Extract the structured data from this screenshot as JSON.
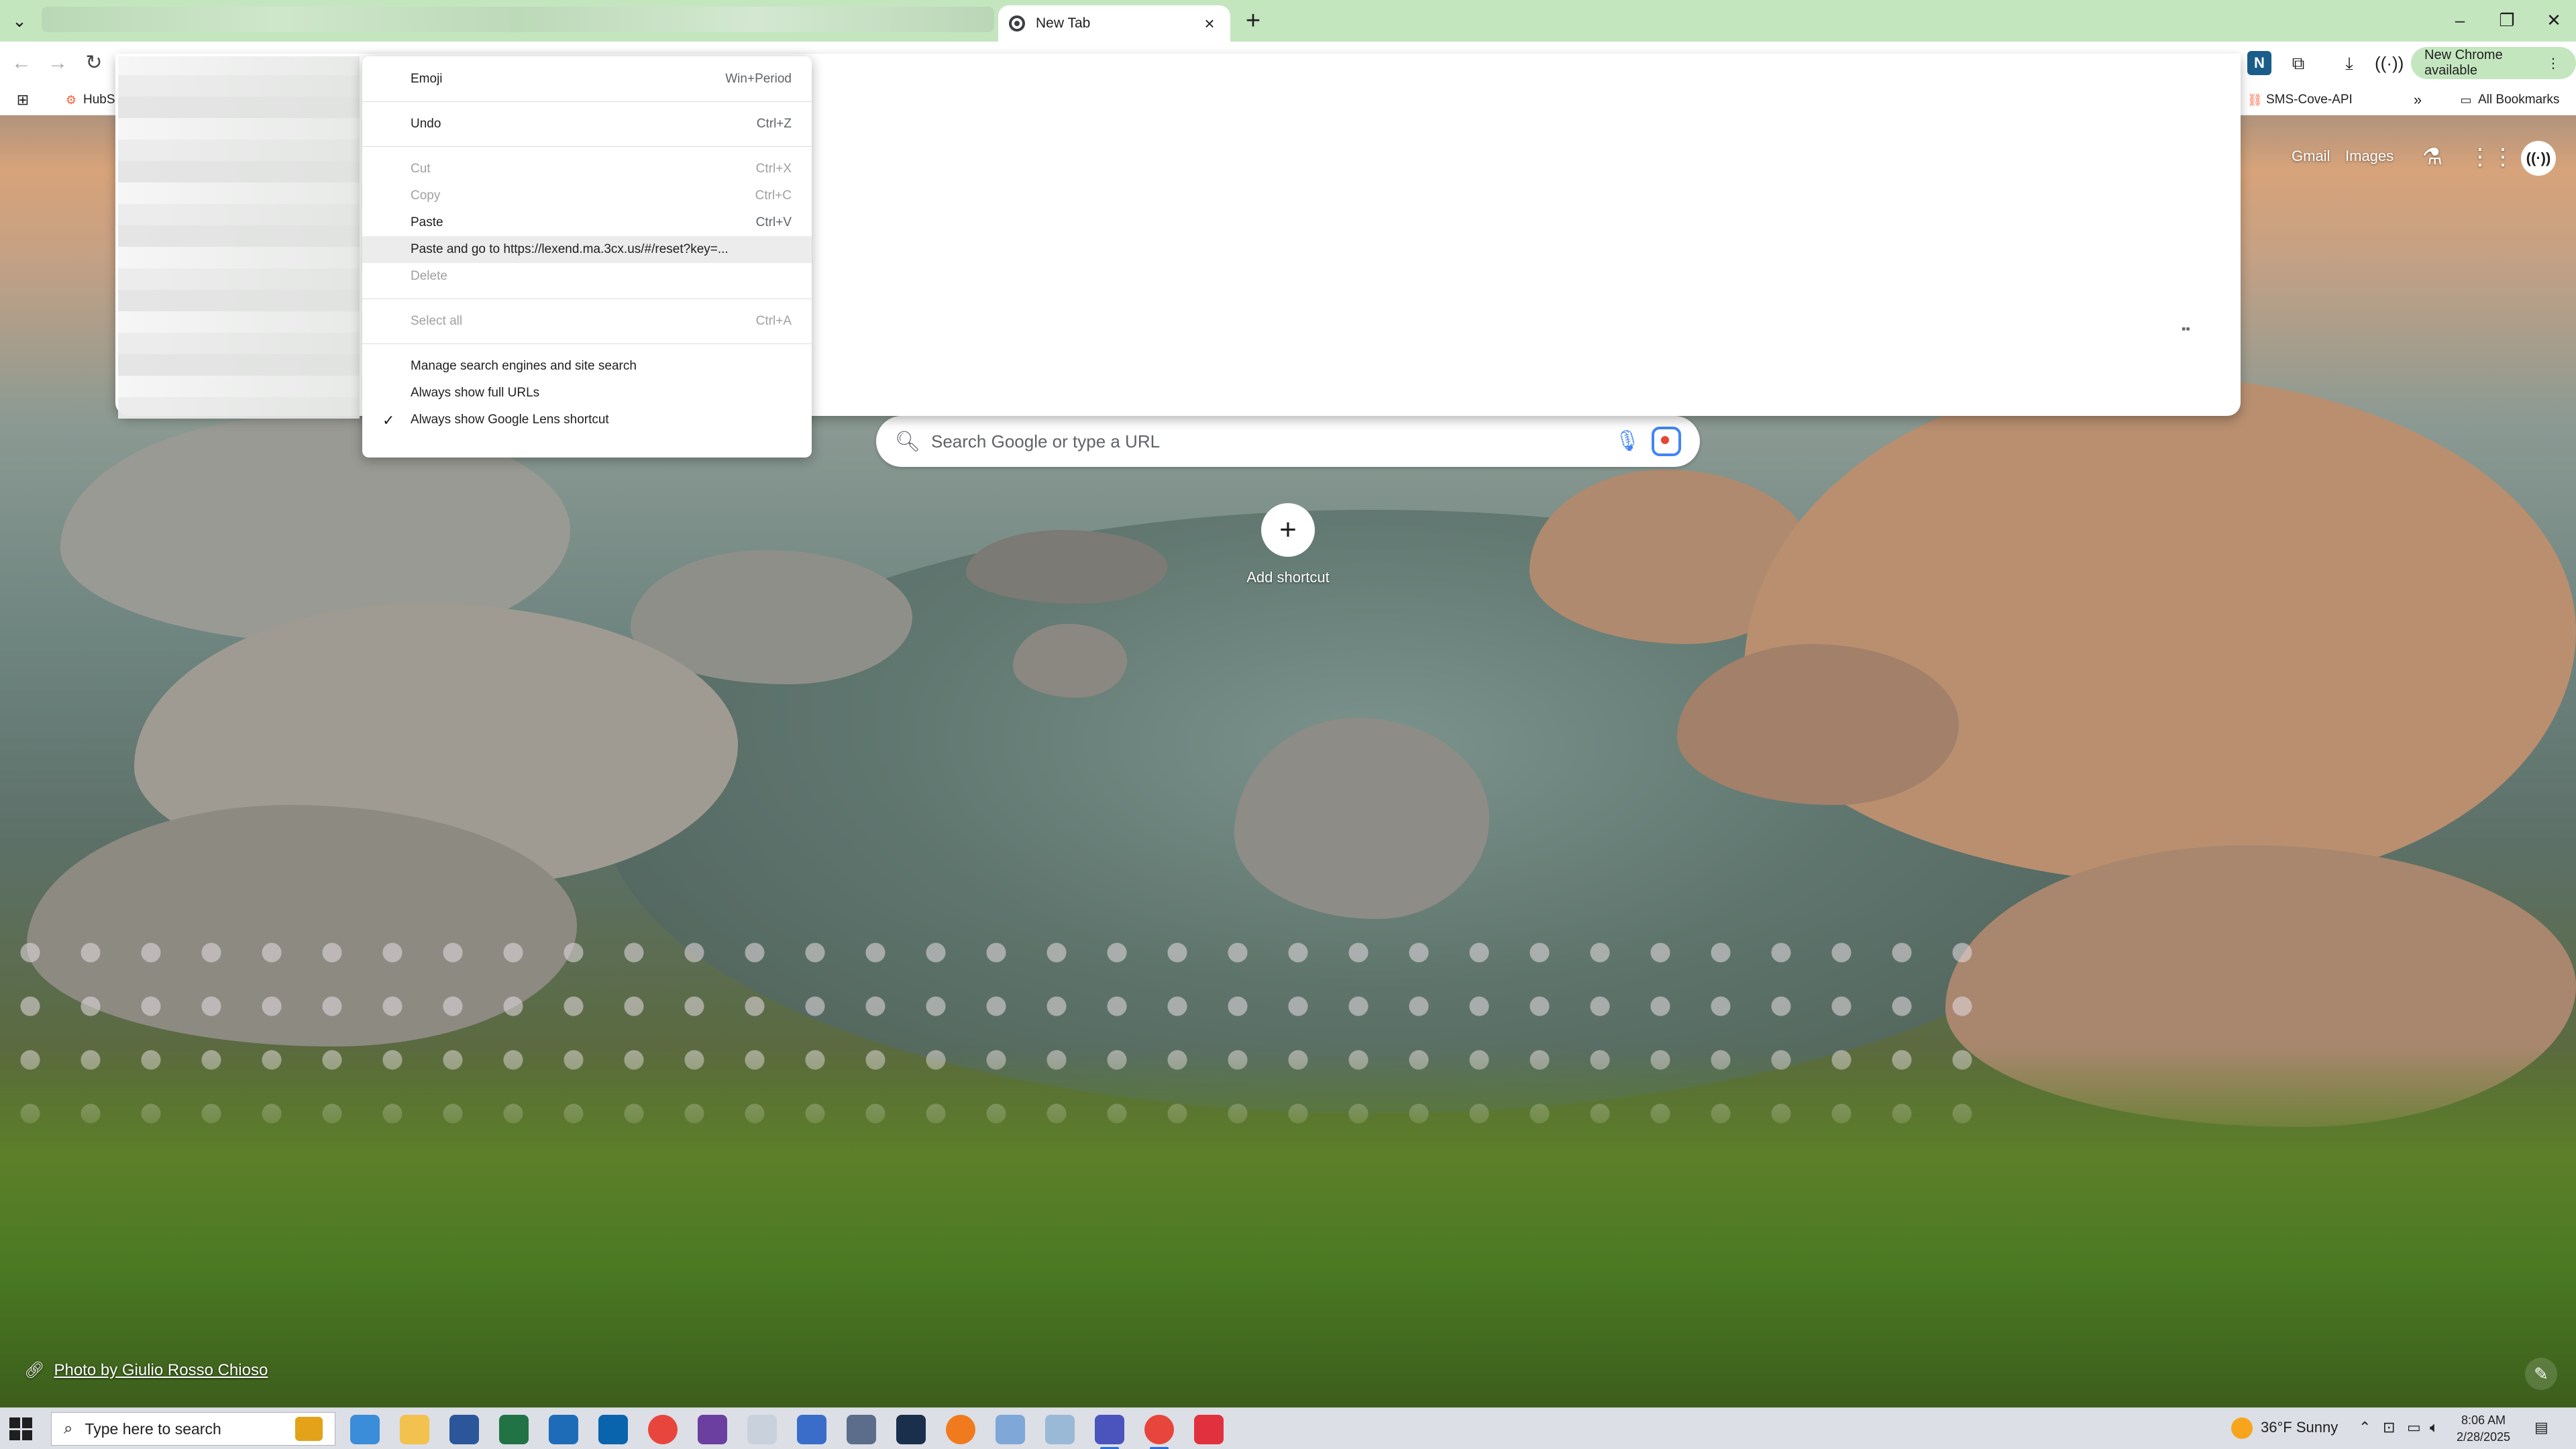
{
  "tab_strip": {
    "active_tab_title": "New Tab"
  },
  "toolbar": {
    "update_label": "New Chrome available"
  },
  "bookmarks": {
    "items": [
      {
        "label": "HubS"
      },
      {
        "label": "SMS-Cove-API"
      }
    ],
    "all_bookmarks_label": "All Bookmarks"
  },
  "context_menu": {
    "items": [
      {
        "label": "Emoji",
        "shortcut": "Win+Period"
      },
      {
        "label": "Undo",
        "shortcut": "Ctrl+Z"
      },
      {
        "label": "Cut",
        "shortcut": "Ctrl+X"
      },
      {
        "label": "Copy",
        "shortcut": "Ctrl+C"
      },
      {
        "label": "Paste",
        "shortcut": "Ctrl+V"
      },
      {
        "label": "Paste and go to https://lexend.ma.3cx.us/#/reset?key=...",
        "shortcut": ""
      },
      {
        "label": "Delete",
        "shortcut": ""
      },
      {
        "label": "Select all",
        "shortcut": "Ctrl+A"
      },
      {
        "label": "Manage search engines and site search",
        "shortcut": ""
      },
      {
        "label": "Always show full URLs",
        "shortcut": ""
      },
      {
        "label": "Always show Google Lens shortcut",
        "shortcut": ""
      }
    ]
  },
  "ntp": {
    "gmail_label": "Gmail",
    "images_label": "Images",
    "search_placeholder": "Search Google or type a URL",
    "add_shortcut_label": "Add shortcut",
    "photo_credit": "Photo by Giulio Rosso Chioso"
  },
  "taskbar": {
    "search_placeholder": "Type here to search",
    "weather": "36°F  Sunny",
    "time": "8:06 AM",
    "date": "2/28/2025"
  },
  "colors": {
    "tab_strip_bg": "#c4e6bf",
    "update_pill_bg": "#c4e6bf",
    "menu_highlight": "#ececec",
    "taskbar_bg": "#dcdfe6"
  }
}
